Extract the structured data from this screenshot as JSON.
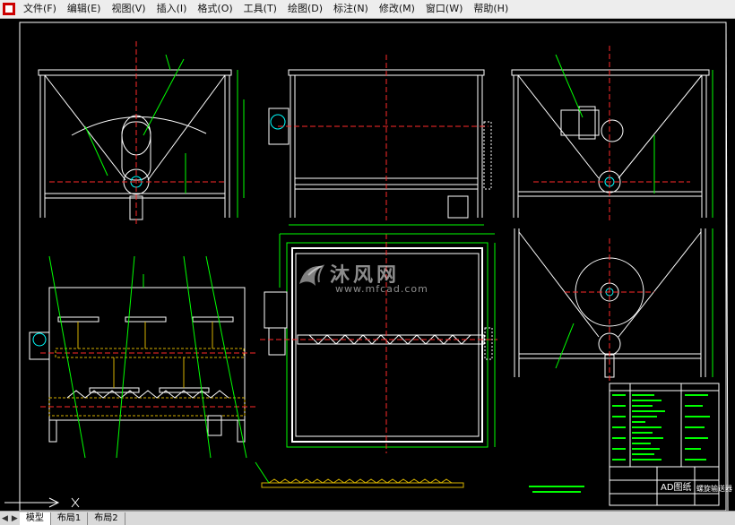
{
  "menu": [
    "文件(F)",
    "编辑(E)",
    "视图(V)",
    "插入(I)",
    "格式(O)",
    "工具(T)",
    "绘图(D)",
    "标注(N)",
    "修改(M)",
    "窗口(W)",
    "帮助(H)"
  ],
  "tabs": {
    "first": "模型",
    "second": "布局1",
    "third": "布局2",
    "nav": [
      "◀",
      "▶"
    ]
  },
  "watermark": {
    "title": "沐风网",
    "url": "www.mfcad.com"
  },
  "title_block": {
    "company": "AD图纸",
    "name": "螺旋输送器"
  },
  "colors": {
    "background": "#000000",
    "frame": "#ffffff",
    "dimension": "#00ff00",
    "centerline": "#ff2a2a",
    "geometry": "#ffffff",
    "hatch": "#d4b000"
  }
}
